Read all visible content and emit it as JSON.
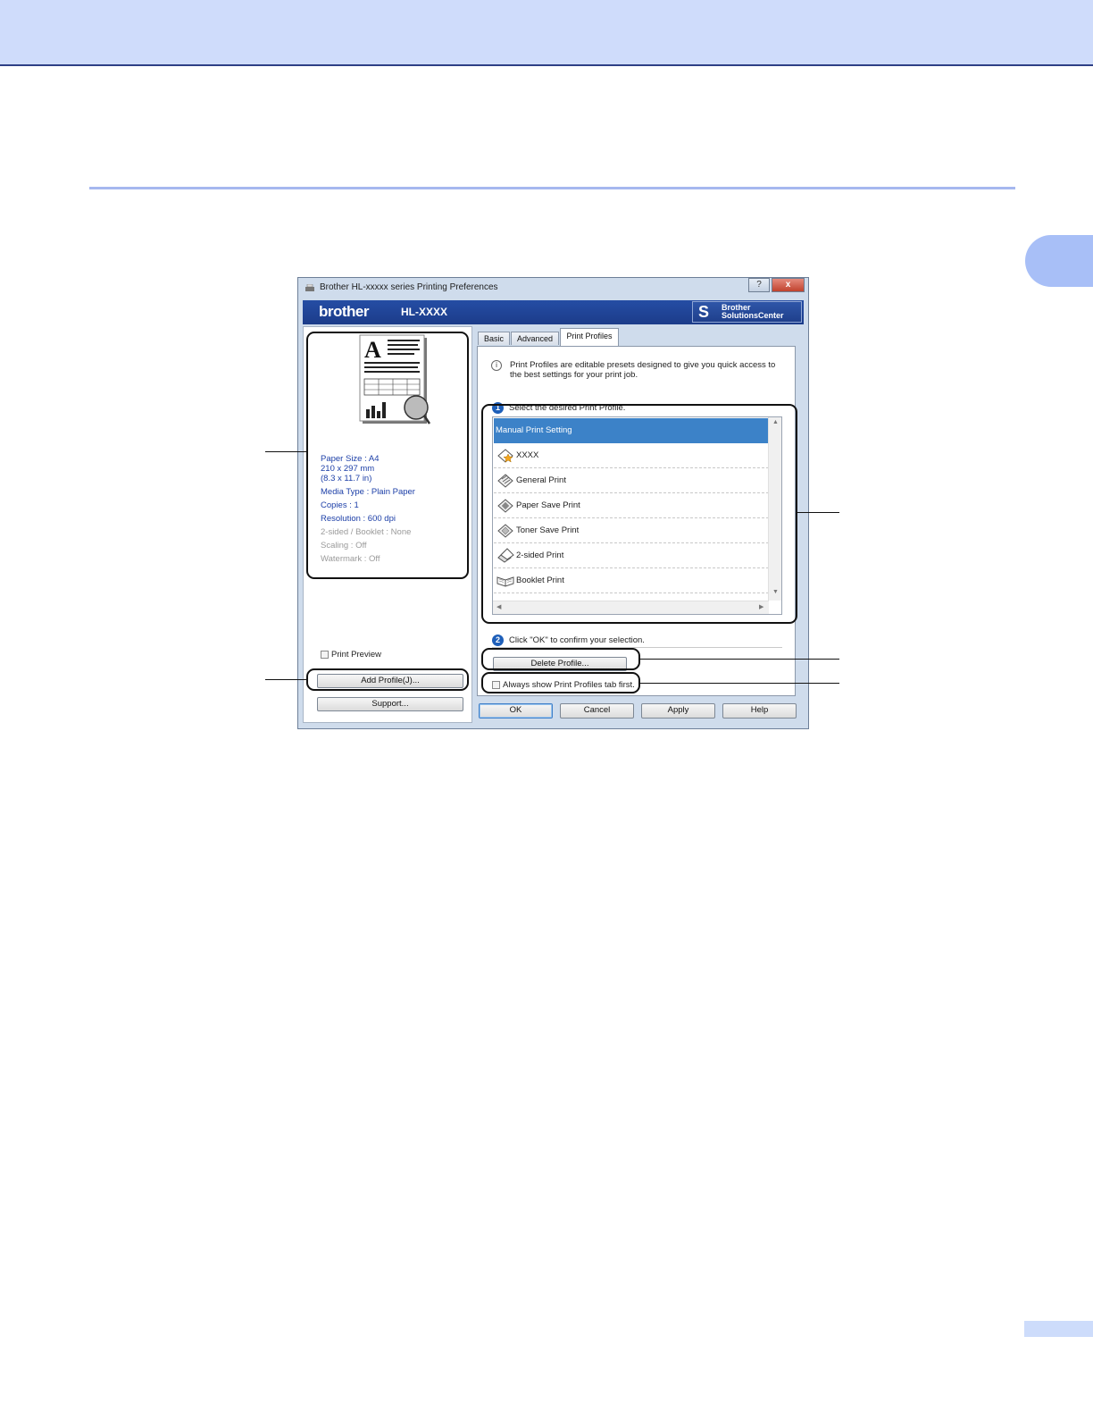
{
  "window": {
    "title": "Brother HL-xxxxx series Printing Preferences",
    "help_button": "?",
    "close_button": "x"
  },
  "banner": {
    "logo": "brother",
    "model": "HL-XXXX",
    "solutions_line1": "Brother",
    "solutions_line2": "SolutionsCenter"
  },
  "preview_pane": {
    "paper_size": "Paper Size : A4",
    "dimensions_mm": "210 x 297 mm",
    "dimensions_in": "(8.3 x 11.7 in)",
    "media_type": "Media Type : Plain Paper",
    "copies": "Copies : 1",
    "resolution": "Resolution : 600 dpi",
    "two_sided": "2-sided / Booklet : None",
    "scaling": "Scaling : Off",
    "watermark": "Watermark : Off",
    "print_preview_label": "Print Preview",
    "add_profile_label": "Add Profile(J)...",
    "support_label": "Support..."
  },
  "tabs": [
    "Basic",
    "Advanced",
    "Print Profiles"
  ],
  "profiles_tab": {
    "intro": "Print Profiles are editable presets designed to give you quick access to the best settings for your print job.",
    "step1_number": "1",
    "step1": "Select the desired Print Profile.",
    "items": [
      "Manual Print Setting",
      "XXXX",
      "General Print",
      "Paper Save Print",
      "Toner Save Print",
      "2-sided Print",
      "Booklet Print"
    ],
    "step2_number": "2",
    "step2": "Click \"OK\" to confirm your selection.",
    "delete_profile_label": "Delete Profile...",
    "always_show_label": "Always show Print Profiles tab first."
  },
  "footer_buttons": {
    "ok": "OK",
    "cancel": "Cancel",
    "apply": "Apply",
    "help": "Help"
  },
  "colors": {
    "header_band": "#cfdcfb",
    "accent_rule": "#a6b8ef",
    "banner_blue": "#1c3c8a",
    "selection_blue": "#3c82c8",
    "settings_text_blue": "#1e40a8"
  }
}
